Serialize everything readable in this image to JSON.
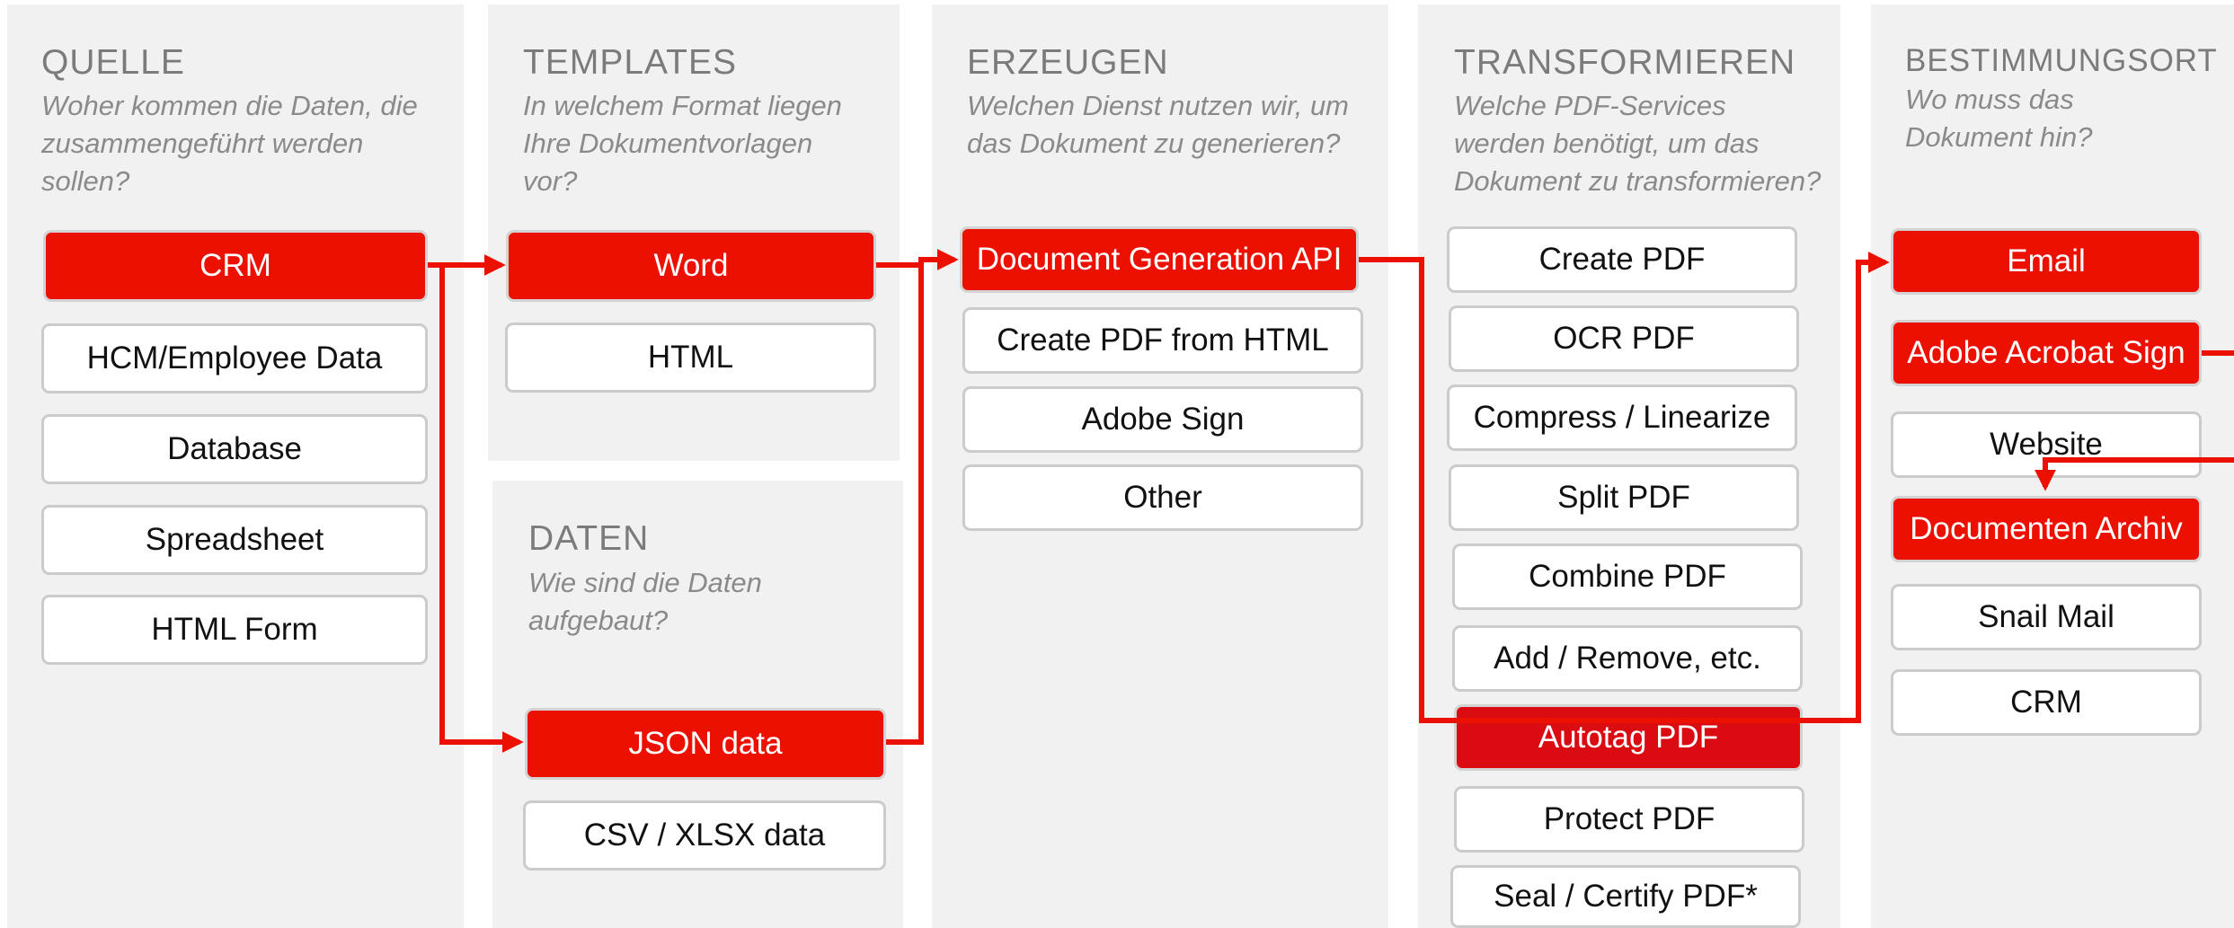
{
  "accent_color": "#eb1000",
  "columns": {
    "quelle": {
      "title": "QUELLE",
      "subtitle": "Woher kommen die Daten, die zusammengeführt werden sollen?",
      "items": [
        "CRM",
        "HCM/Employee Data",
        "Database",
        "Spreadsheet",
        "HTML Form"
      ]
    },
    "templates": {
      "title": "TEMPLATES",
      "subtitle": "In welchem Format liegen Ihre Dokumentvorlagen vor?",
      "items": [
        "Word",
        "HTML"
      ]
    },
    "daten": {
      "title": "DATEN",
      "subtitle": "Wie sind die Daten aufgebaut?",
      "items": [
        "JSON data",
        "CSV / XLSX data"
      ]
    },
    "erzeugen": {
      "title": "ERZEUGEN",
      "subtitle": "Welchen Dienst nutzen wir, um das Dokument zu generieren?",
      "items": [
        "Document Generation API",
        "Create PDF from HTML",
        "Adobe Sign",
        "Other"
      ]
    },
    "transformieren": {
      "title": "TRANSFORMIEREN",
      "subtitle": "Welche PDF-Services  werden benötigt, um das Dokument zu transformieren?",
      "items": [
        "Create PDF",
        "OCR PDF",
        "Compress / Linearize",
        "Split PDF",
        "Combine PDF",
        "Add / Remove, etc.",
        "Autotag PDF",
        "Protect PDF",
        "Seal / Certify PDF*"
      ]
    },
    "bestimmungsort": {
      "title": "BESTIMMUNGSORT",
      "subtitle": "Wo muss das Dokument hin?",
      "items": [
        "Email",
        "Adobe Acrobat Sign",
        "Website",
        "Documenten Archiv",
        "Snail Mail",
        "CRM"
      ]
    }
  }
}
